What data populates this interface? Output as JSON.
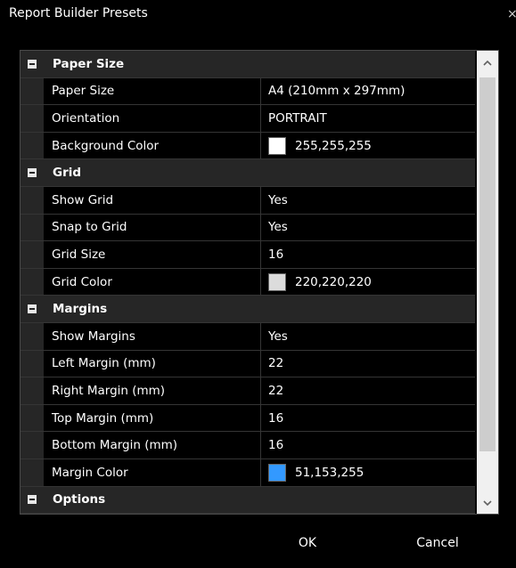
{
  "window": {
    "title": "Report Builder Presets",
    "close_glyph": "×"
  },
  "property_grid": {
    "categories": [
      {
        "label": "Paper Size",
        "properties": [
          {
            "name": "Paper Size",
            "value": "A4 (210mm x 297mm)"
          },
          {
            "name": "Orientation",
            "value": "PORTRAIT"
          },
          {
            "name": "Background Color",
            "value": "255,255,255",
            "swatch": "#ffffff"
          }
        ]
      },
      {
        "label": "Grid",
        "properties": [
          {
            "name": "Show Grid",
            "value": "Yes"
          },
          {
            "name": "Snap to Grid",
            "value": "Yes"
          },
          {
            "name": "Grid Size",
            "value": "16"
          },
          {
            "name": "Grid Color",
            "value": "220,220,220",
            "swatch": "#dcdcdc"
          }
        ]
      },
      {
        "label": "Margins",
        "properties": [
          {
            "name": "Show Margins",
            "value": "Yes"
          },
          {
            "name": "Left Margin (mm)",
            "value": "22"
          },
          {
            "name": "Right Margin (mm)",
            "value": "22"
          },
          {
            "name": "Top Margin (mm)",
            "value": "16"
          },
          {
            "name": "Bottom Margin (mm)",
            "value": "16"
          },
          {
            "name": "Margin Color",
            "value": "51,153,255",
            "swatch": "#3399ff"
          }
        ]
      },
      {
        "label": "Options",
        "properties": []
      }
    ]
  },
  "scrollbar": {
    "up_icon": "chevron-up-icon",
    "down_icon": "chevron-down-icon"
  },
  "buttons": {
    "ok_label": "OK",
    "cancel_label": "Cancel"
  }
}
